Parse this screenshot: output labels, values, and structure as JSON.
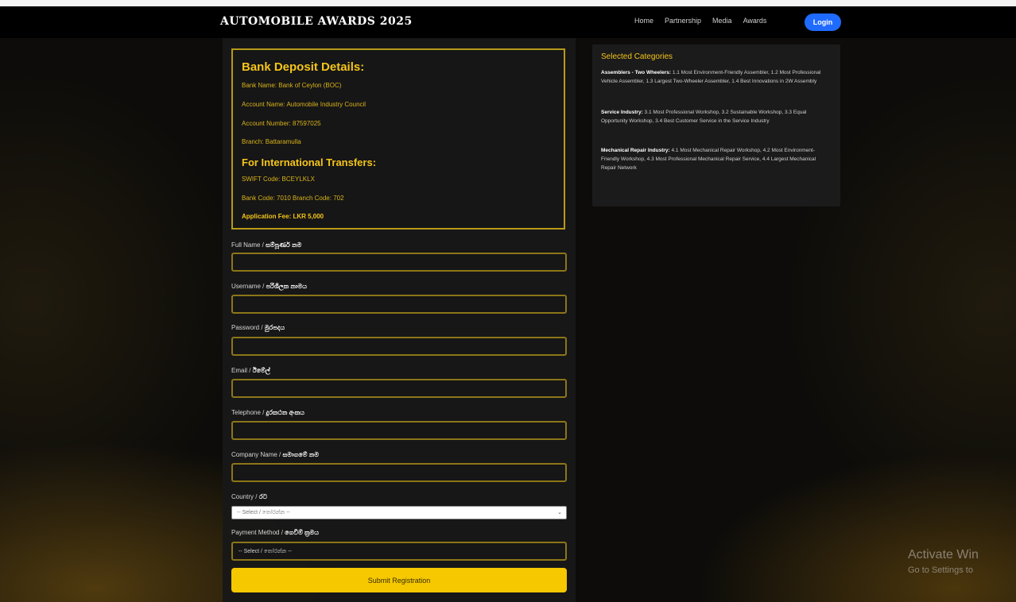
{
  "header": {
    "brand": "AUTOMOBILE AWARDS 2025",
    "nav": [
      "Home",
      "Partnership",
      "Media",
      "Awards"
    ],
    "login": "Login"
  },
  "bank": {
    "title": "Bank Deposit Details:",
    "lines": [
      "Bank Name: Bank of Ceylon (BOC)",
      "Account Name: Automobile Industry Council",
      "Account Number: 87597025",
      "Branch: Battaramulla"
    ],
    "intl_title": "For International Transfers:",
    "intl_lines": [
      "SWIFT Code: BCEYLKLX",
      "Bank Code: 7010 Branch Code: 702"
    ],
    "fee": "Application Fee: LKR 5,000"
  },
  "form": {
    "full_name": {
      "label": "Full Name / ",
      "label_local": "සම්පූර්ණ නම"
    },
    "username": {
      "label": "Username / ",
      "label_local": "පරිශීලක නාමය"
    },
    "password": {
      "label": "Password / ",
      "label_local": "මුරපදය"
    },
    "email": {
      "label": "Email / ",
      "label_local": "ඊමේල්"
    },
    "telephone": {
      "label": "Telephone / ",
      "label_local": "දුරකථන අංකය"
    },
    "company": {
      "label": "Company Name / ",
      "label_local": "සමාගමේ නම"
    },
    "country": {
      "label": "Country / ",
      "label_local": "රට",
      "value": "-- Select / තෝරන්න --"
    },
    "payment": {
      "label": "Payment Method / ",
      "label_local": "ගෙවීම් ක්‍රමය",
      "value": "-- Select / තෝරන්න --"
    },
    "submit": "Submit Registration"
  },
  "categories": {
    "title": "Selected Categories",
    "blocks": [
      {
        "name": "Assemblers - Two Wheelers:",
        "text": " 1.1 Most Environment-Friendly Assembler, 1.2 Most Professional Vehicle Assembler, 1.3 Largest Two-Wheeler Assembler, 1.4 Best Innovations in 2W Assembly"
      },
      {
        "name": "Service Industry:",
        "text": " 3.1 Most Professional Workshop, 3.2 Sustainable Workshop, 3.3 Equal Opportunity Workshop, 3.4 Best Customer Service in the Service Industry"
      },
      {
        "name": "Mechanical Repair Industry:",
        "text": " 4.1 Most Mechanical Repair Workshop, 4.2 Most Environment-Friendly Workshop, 4.3 Most Professional Mechanical Repair Service, 4.4 Largest Mechanical Repair Network"
      }
    ]
  },
  "watermark": {
    "line1": "Activate Win",
    "line2": "Go to Settings to"
  }
}
